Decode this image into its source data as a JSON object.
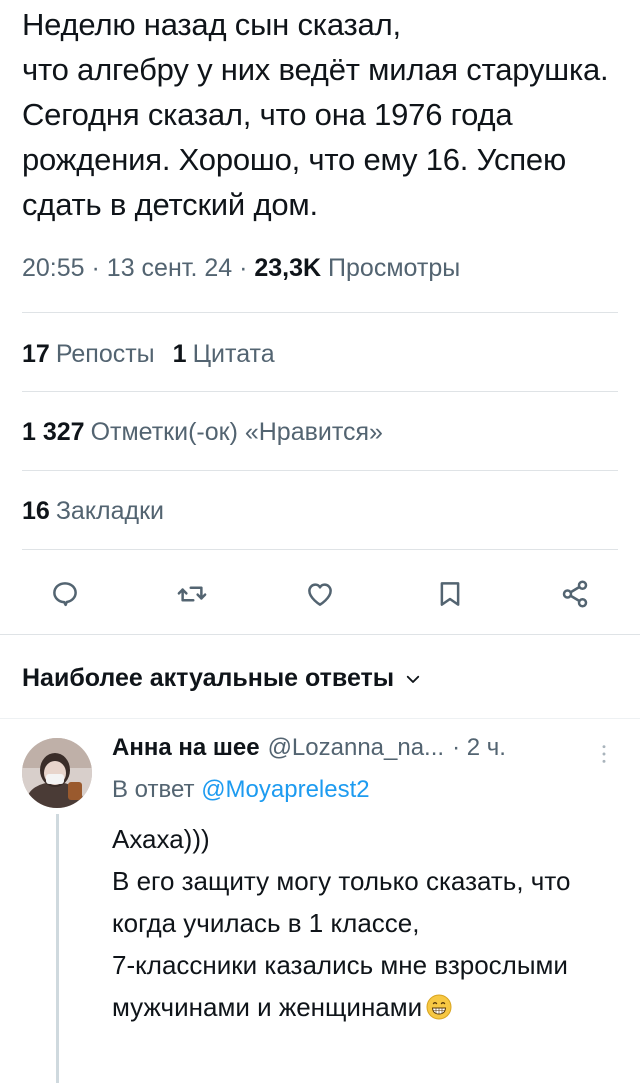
{
  "tweet": {
    "text": "Неделю назад сын сказал,\nчто алгебру у них ведёт милая старушка. Сегодня сказал, что она 1976 года рождения. Хорошо, что ему 16. Успею сдать в детский дом.",
    "time": "20:55",
    "date": "13 сент. 24",
    "views_count": "23,3K",
    "views_label": "Просмотры",
    "separator": "·"
  },
  "stats": {
    "reposts_count": "17",
    "reposts_label": "Репосты",
    "quotes_count": "1",
    "quotes_label": "Цитата",
    "likes_count": "1 327",
    "likes_label": "Отметки(-ок) «Нравится»",
    "bookmarks_count": "16",
    "bookmarks_label": "Закладки"
  },
  "actions": [
    {
      "icon": "reply-icon"
    },
    {
      "icon": "repost-icon"
    },
    {
      "icon": "like-icon"
    },
    {
      "icon": "bookmark-icon"
    },
    {
      "icon": "share-icon"
    }
  ],
  "replies_section": {
    "header": "Наиболее актуальные ответы"
  },
  "reply": {
    "name": "Анна на шее",
    "handle": "@Lozanna_na...",
    "time": "· 2 ч.",
    "replying_to_label": "В ответ",
    "replying_to_handle": "@Moyaprelest2",
    "text": "Ахаха)))\nВ его защиту могу только сказать, что когда училась в 1 классе,\n7-классники казались мне взрослыми мужчинами и женщинами",
    "emoji": "grinning-face-emoji"
  },
  "colors": {
    "text": "#0f1419",
    "secondary": "#536471",
    "link": "#1d9bf0",
    "divider": "#dfe3e6"
  }
}
